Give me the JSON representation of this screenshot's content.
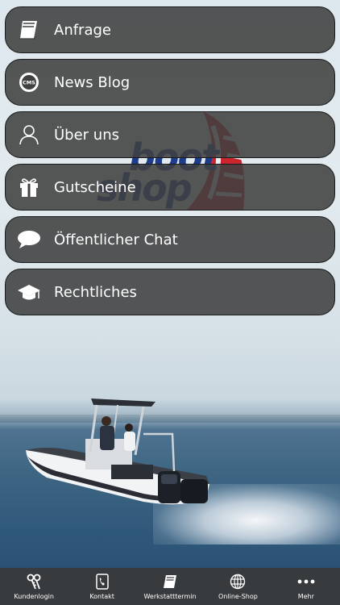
{
  "brand": {
    "logo_line1": "boot",
    "logo_line2": "shop",
    "logo_color": "#1d3d8c",
    "sail_color": "#c9262e"
  },
  "menu": {
    "items": [
      {
        "label": "Anfrage",
        "icon": "book-icon"
      },
      {
        "label": "News Blog",
        "icon": "cms-badge-icon",
        "icon_text": "CMS"
      },
      {
        "label": "Über uns",
        "icon": "person-icon"
      },
      {
        "label": "Gutscheine",
        "icon": "gift-icon"
      },
      {
        "label": "Öffentlicher Chat",
        "icon": "chat-bubble-icon"
      },
      {
        "label": "Rechtliches",
        "icon": "graduation-cap-icon"
      }
    ]
  },
  "tabbar": {
    "items": [
      {
        "label": "Kundenlogin",
        "icon": "key-icon"
      },
      {
        "label": "Kontakt",
        "icon": "phone-icon"
      },
      {
        "label": "Werkstatttermin",
        "icon": "book-icon"
      },
      {
        "label": "Online-Shop",
        "icon": "globe-icon"
      },
      {
        "label": "Mehr",
        "icon": "more-dots-icon"
      }
    ]
  },
  "colors": {
    "menu_bg": "#404040",
    "text": "#ffffff",
    "tabbar_bg": "#3a3a3a"
  }
}
